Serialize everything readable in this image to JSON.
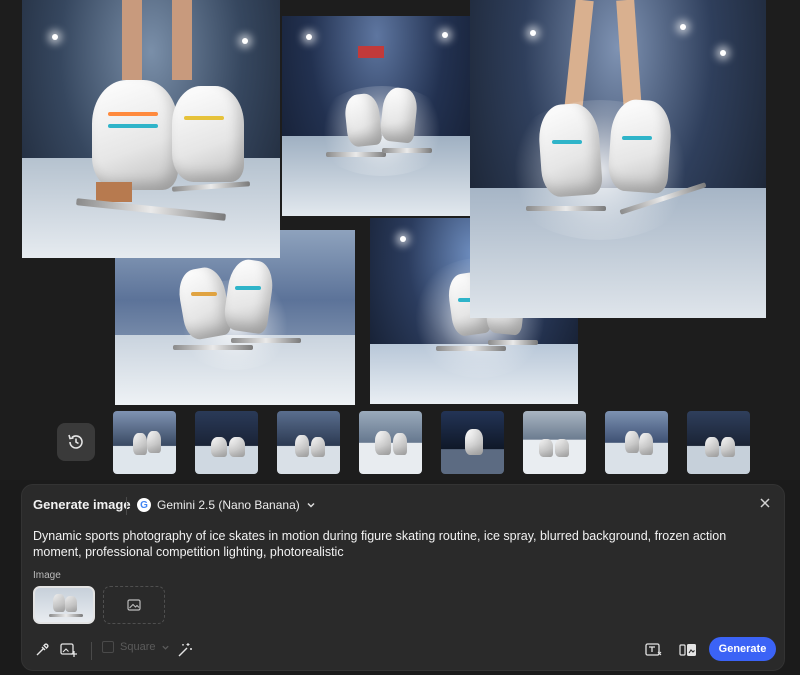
{
  "panel": {
    "title": "Generate image",
    "model_label": "Gemini 2.5 (Nano Banana)",
    "model_icon": "google-g-icon",
    "prompt": "Dynamic sports photography of ice skates in motion during figure skating routine, ice spray, blurred background, frozen action moment, professional competition lighting, photorealistic",
    "image_label": "Image",
    "aspect_label": "Square",
    "generate_label": "Generate"
  },
  "icons": {
    "history": "history-icon",
    "close": "close-icon",
    "eyedropper": "eyedropper-icon",
    "add_image": "add-image-icon",
    "magic": "magic-wand-icon",
    "text_image": "text-to-image-icon",
    "compare": "compare-icon"
  },
  "colors": {
    "accent": "#3b63f6",
    "panel_bg": "#2a2a2a",
    "page_bg": "#1b1b1b"
  },
  "thumbnails": [
    "thumb-1",
    "thumb-2",
    "thumb-3",
    "thumb-4",
    "thumb-5",
    "thumb-6",
    "thumb-7",
    "thumb-8"
  ]
}
